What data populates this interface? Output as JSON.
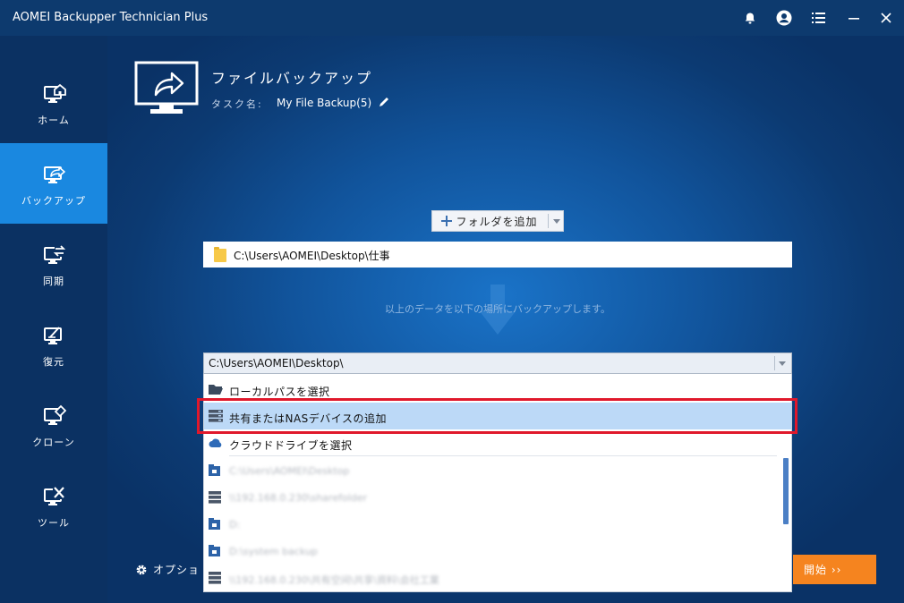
{
  "app": {
    "title": "AOMEI Backupper Technician Plus"
  },
  "titlebar": {
    "icons": [
      "bell-icon",
      "user-icon",
      "menu-icon",
      "minimize-icon",
      "close-icon"
    ]
  },
  "sidebar": {
    "items": [
      {
        "label": "ホーム",
        "icon": "home-monitor-icon",
        "active": false
      },
      {
        "label": "バックアップ",
        "icon": "backup-monitor-icon",
        "active": true
      },
      {
        "label": "同期",
        "icon": "sync-monitor-icon",
        "active": false
      },
      {
        "label": "復元",
        "icon": "restore-monitor-icon",
        "active": false
      },
      {
        "label": "クローン",
        "icon": "clone-monitor-icon",
        "active": false
      },
      {
        "label": "ツール",
        "icon": "tools-monitor-icon",
        "active": false
      }
    ]
  },
  "task": {
    "title": "ファイルバックアップ",
    "name_label": "タスク名:",
    "name_value": "My File Backup(5)"
  },
  "source": {
    "add_folder_label": "フォルダを追加",
    "path": "C:\\Users\\AOMEI\\Desktop\\仕事"
  },
  "hint": "以上のデータを以下の場所にバックアップします。",
  "destination": {
    "value": "C:\\Users\\AOMEI\\Desktop\\",
    "options": [
      {
        "label": "ローカルパスを選択",
        "icon": "folder-open-icon"
      },
      {
        "label": "共有またはNASデバイスの追加",
        "icon": "nas-server-icon",
        "selected": true
      },
      {
        "label": "クラウドドライブを選択",
        "icon": "cloud-icon"
      }
    ],
    "recent": [
      {
        "label": "C:\\Users\\AOMEI\\Desktop",
        "icon": "local-folder-icon"
      },
      {
        "label": "\\\\192.168.0.230\\sharefolder",
        "icon": "nas-server-icon"
      },
      {
        "label": "D:",
        "icon": "local-folder-icon"
      },
      {
        "label": "D:\\system backup",
        "icon": "local-folder-icon"
      },
      {
        "label": "\\\\192.168.0.230\\共有空间\\共享\\資料\\会社工業",
        "icon": "nas-server-icon"
      }
    ]
  },
  "footer": {
    "options_label": "オプショ",
    "start_label": "開始 ››"
  },
  "colors": {
    "accent": "#1a88e0",
    "start": "#f5841f",
    "highlight": "#e0182b",
    "selected_row": "#bcd9f7"
  }
}
